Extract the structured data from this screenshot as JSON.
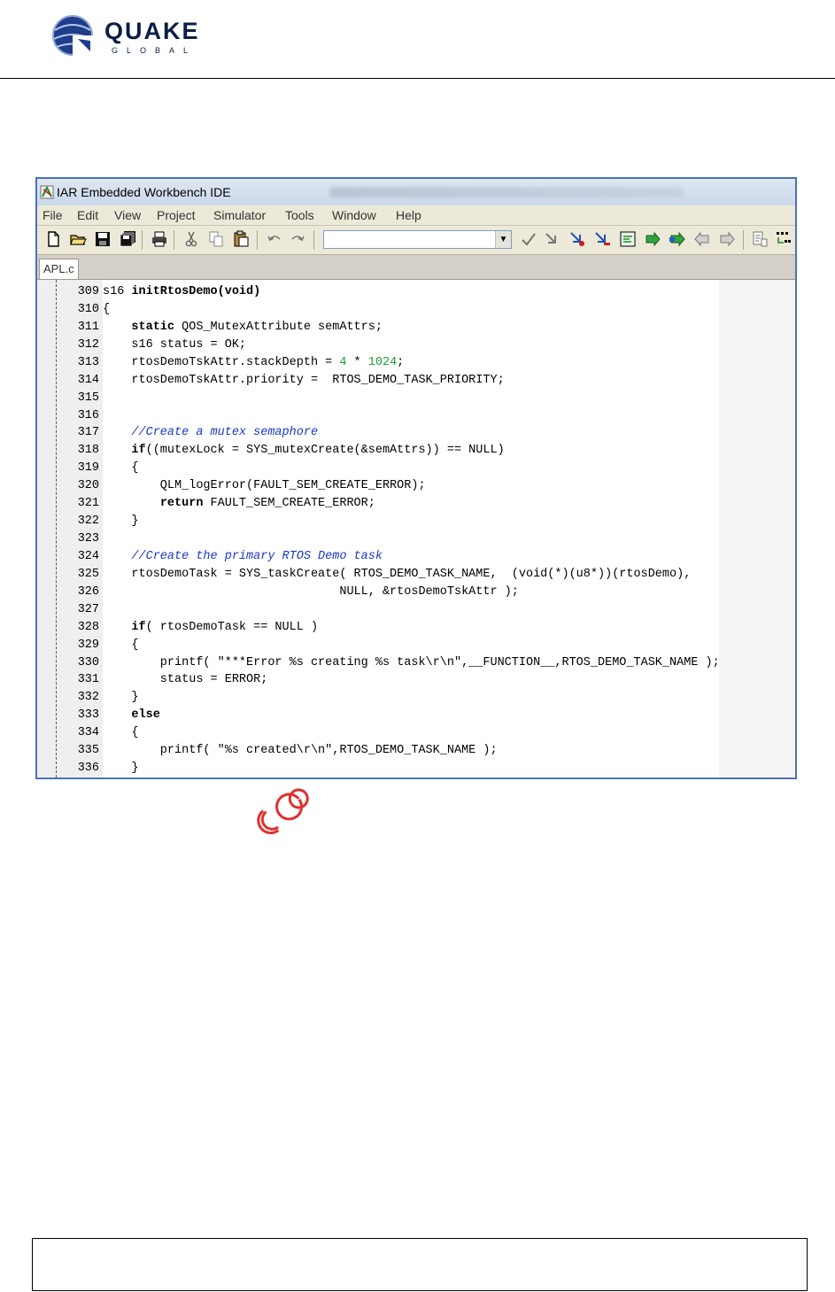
{
  "header": {
    "brand_name": "QUAKE",
    "brand_sub": "GLOBAL"
  },
  "window": {
    "title": "IAR Embedded Workbench IDE",
    "menu": [
      "File",
      "Edit",
      "View",
      "Project",
      "Simulator",
      "Tools",
      "Window",
      "Help"
    ],
    "toolbar_combo_value": "",
    "tab_label": "APL.c"
  },
  "colors": {
    "frame_border": "#4a72b8",
    "comment": "#1a38c7",
    "number": "#1f9c3a",
    "watermark": "#e03030"
  },
  "code": {
    "lines": [
      {
        "num": "309",
        "segs": [
          {
            "t": "s16 ",
            "c": ""
          },
          {
            "t": "initRtosDemo(void)",
            "c": "kw"
          }
        ]
      },
      {
        "num": "310",
        "segs": [
          {
            "t": "{",
            "c": ""
          }
        ]
      },
      {
        "num": "311",
        "segs": [
          {
            "t": "    ",
            "c": ""
          },
          {
            "t": "static",
            "c": "kw"
          },
          {
            "t": " QOS_MutexAttribute semAttrs;",
            "c": ""
          }
        ]
      },
      {
        "num": "312",
        "segs": [
          {
            "t": "    s16 status = OK;",
            "c": ""
          }
        ]
      },
      {
        "num": "313",
        "segs": [
          {
            "t": "    rtosDemoTskAttr.stackDepth = ",
            "c": ""
          },
          {
            "t": "4",
            "c": "nm"
          },
          {
            "t": " * ",
            "c": ""
          },
          {
            "t": "1024",
            "c": "nm"
          },
          {
            "t": ";",
            "c": ""
          }
        ]
      },
      {
        "num": "314",
        "segs": [
          {
            "t": "    rtosDemoTskAttr.priority =  RTOS_DEMO_TASK_PRIORITY;",
            "c": ""
          }
        ]
      },
      {
        "num": "315",
        "segs": []
      },
      {
        "num": "316",
        "segs": []
      },
      {
        "num": "317",
        "segs": [
          {
            "t": "    ",
            "c": ""
          },
          {
            "t": "//Create a mutex semaphore",
            "c": "cm"
          }
        ]
      },
      {
        "num": "318",
        "segs": [
          {
            "t": "    ",
            "c": ""
          },
          {
            "t": "if",
            "c": "kw"
          },
          {
            "t": "((mutexLock = SYS_mutexCreate(&semAttrs)) == NULL)",
            "c": ""
          }
        ]
      },
      {
        "num": "319",
        "segs": [
          {
            "t": "    {",
            "c": ""
          }
        ]
      },
      {
        "num": "320",
        "segs": [
          {
            "t": "        QLM_logError(FAULT_SEM_CREATE_ERROR);",
            "c": ""
          }
        ]
      },
      {
        "num": "321",
        "segs": [
          {
            "t": "        ",
            "c": ""
          },
          {
            "t": "return",
            "c": "kw"
          },
          {
            "t": " FAULT_SEM_CREATE_ERROR;",
            "c": ""
          }
        ]
      },
      {
        "num": "322",
        "segs": [
          {
            "t": "    }",
            "c": ""
          }
        ]
      },
      {
        "num": "323",
        "segs": []
      },
      {
        "num": "324",
        "segs": [
          {
            "t": "    ",
            "c": ""
          },
          {
            "t": "//Create the primary RTOS Demo task",
            "c": "cm"
          }
        ]
      },
      {
        "num": "325",
        "segs": [
          {
            "t": "    rtosDemoTask = SYS_taskCreate( RTOS_DEMO_TASK_NAME,  (void(*)(u8*))(rtosDemo),",
            "c": ""
          }
        ]
      },
      {
        "num": "326",
        "segs": [
          {
            "t": "                                 NULL, &rtosDemoTskAttr );",
            "c": ""
          }
        ]
      },
      {
        "num": "327",
        "segs": []
      },
      {
        "num": "328",
        "segs": [
          {
            "t": "    ",
            "c": ""
          },
          {
            "t": "if",
            "c": "kw"
          },
          {
            "t": "( rtosDemoTask == NULL )",
            "c": ""
          }
        ]
      },
      {
        "num": "329",
        "segs": [
          {
            "t": "    {",
            "c": ""
          }
        ]
      },
      {
        "num": "330",
        "segs": [
          {
            "t": "        printf( \"***Error %s creating %s task\\r\\n\",__FUNCTION__,RTOS_DEMO_TASK_NAME );",
            "c": ""
          }
        ]
      },
      {
        "num": "331",
        "segs": [
          {
            "t": "        status = ERROR;",
            "c": ""
          }
        ]
      },
      {
        "num": "332",
        "segs": [
          {
            "t": "    }",
            "c": ""
          }
        ]
      },
      {
        "num": "333",
        "segs": [
          {
            "t": "    ",
            "c": ""
          },
          {
            "t": "else",
            "c": "kw"
          }
        ]
      },
      {
        "num": "334",
        "segs": [
          {
            "t": "    {",
            "c": ""
          }
        ]
      },
      {
        "num": "335",
        "segs": [
          {
            "t": "        printf( \"%s created\\r\\n\",RTOS_DEMO_TASK_NAME );",
            "c": ""
          }
        ]
      },
      {
        "num": "336",
        "segs": [
          {
            "t": "    }",
            "c": ""
          }
        ]
      }
    ]
  }
}
